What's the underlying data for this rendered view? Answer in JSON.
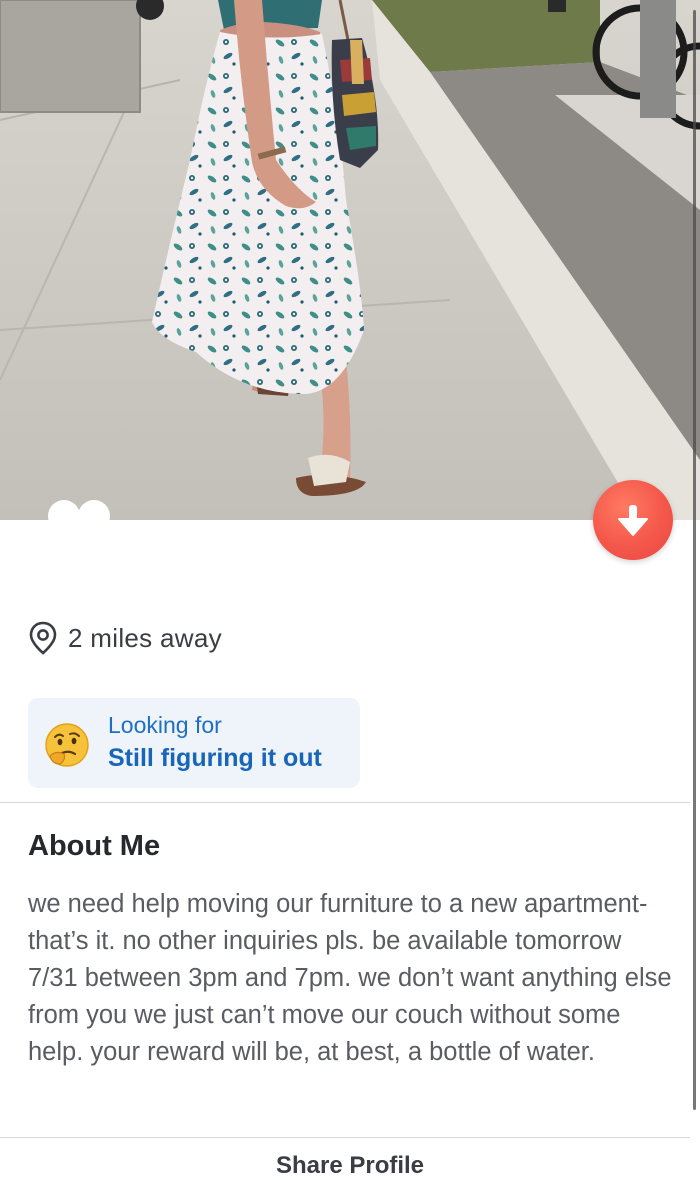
{
  "profile": {
    "distance": "2 miles away",
    "looking_for": {
      "label": "Looking for",
      "value": "Still figuring it out",
      "emoji": "thinking-face-emoji"
    },
    "about": {
      "title": "About Me",
      "text": "we need help moving our furniture to a new apartment- that’s it. no other inquiries pls. be available tomorrow 7/31 between 3pm and 7pm. we don’t want anything else from you we just can’t move our couch without some help. your reward will be, at best, a bottle of water."
    },
    "share_label": "Share Profile"
  },
  "icons": {
    "location": "location-pin-icon",
    "collapse": "arrow-down-icon"
  },
  "colors": {
    "accent_red": "#f4574a",
    "link_blue": "#1966b8",
    "card_bg": "#eef4fa",
    "text_dark": "#26282d",
    "text_body": "#5a5c62"
  }
}
